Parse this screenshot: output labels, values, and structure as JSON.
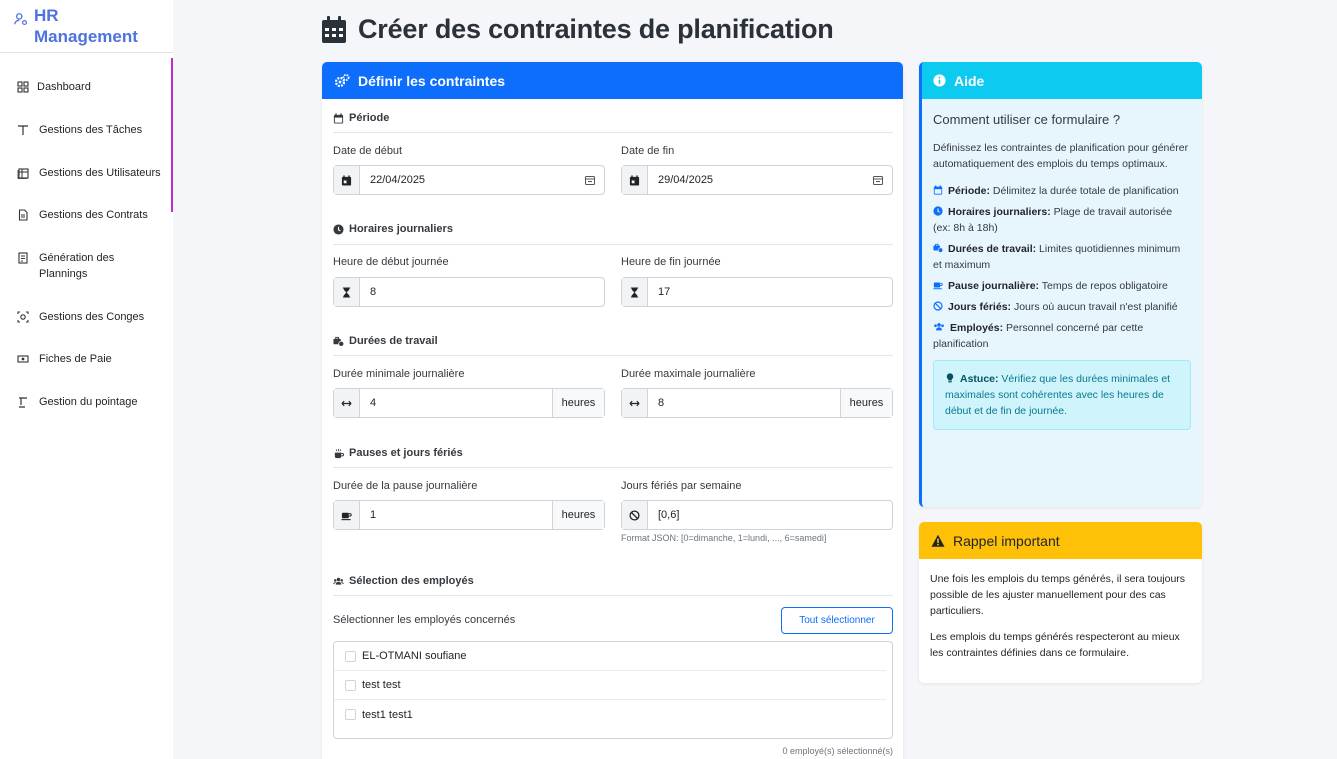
{
  "brand": {
    "line1": "HR",
    "line2": "Management"
  },
  "sidebar": {
    "items": [
      {
        "label": "Dashboard",
        "icon": "dashboard-icon"
      },
      {
        "label": "Gestions des Tâches",
        "icon": "tasks-icon"
      },
      {
        "label": "Gestions des Utilisateurs",
        "icon": "users-table-icon"
      },
      {
        "label": "Gestions des Contrats",
        "icon": "document-icon"
      },
      {
        "label": "Génération des Plannings",
        "icon": "planning-icon"
      },
      {
        "label": "Gestions des Conges",
        "icon": "leave-icon"
      },
      {
        "label": "Fiches de Paie",
        "icon": "payslip-icon"
      },
      {
        "label": "Gestion du pointage",
        "icon": "clock-in-icon"
      }
    ]
  },
  "page": {
    "title": "Créer des contraintes de planification"
  },
  "form": {
    "header": "Définir les contraintes",
    "period": {
      "title": "Période",
      "start_label": "Date de début",
      "start_value": "22/04/2025",
      "end_label": "Date de fin",
      "end_value": "29/04/2025"
    },
    "hours": {
      "title": "Horaires journaliers",
      "start_label": "Heure de début journée",
      "start_value": "8",
      "end_label": "Heure de fin journée",
      "end_value": "17"
    },
    "durations": {
      "title": "Durées de travail",
      "min_label": "Durée minimale journalière",
      "min_value": "4",
      "max_label": "Durée maximale journalière",
      "max_value": "8",
      "unit": "heures"
    },
    "breaks": {
      "title": "Pauses et jours fériés",
      "pause_label": "Durée de la pause journalière",
      "pause_value": "1",
      "unit": "heures",
      "holidays_label": "Jours fériés par semaine",
      "holidays_value": "[0,6]",
      "holidays_hint": "Format JSON: [0=dimanche, 1=lundi, ..., 6=samedi]"
    },
    "employees": {
      "title": "Sélection des employés",
      "select_label": "Sélectionner les employés concernés",
      "select_all": "Tout sélectionner",
      "list": [
        "EL-OTMANI soufiane",
        "test test",
        "test1 test1"
      ],
      "count_text": "0 employé(s) sélectionné(s)"
    }
  },
  "help": {
    "header": "Aide",
    "question": "Comment utiliser ce formulaire ?",
    "intro": "Définissez les contraintes de planification pour générer automatiquement des emplois du temps optimaux.",
    "items": [
      {
        "term": "Période:",
        "text": " Délimitez la durée totale de planification"
      },
      {
        "term": "Horaires journaliers:",
        "text": " Plage de travail autorisée (ex: 8h à 18h)"
      },
      {
        "term": "Durées de travail:",
        "text": " Limites quotidiennes minimum et maximum"
      },
      {
        "term": "Pause journalière:",
        "text": " Temps de repos obligatoire"
      },
      {
        "term": "Jours fériés:",
        "text": " Jours où aucun travail n'est planifié"
      },
      {
        "term": "Employés:",
        "text": " Personnel concerné par cette planification"
      }
    ],
    "tip_term": "Astuce:",
    "tip_text": " Vérifiez que les durées minimales et maximales sont cohérentes avec les heures de début et de fin de journée."
  },
  "warning": {
    "header": "Rappel important",
    "p1": "Une fois les emplois du temps générés, il sera toujours possible de les ajuster manuellement pour des cas particuliers.",
    "p2": "Les emplois du temps générés respecteront au mieux les contraintes définies dans ce formulaire."
  },
  "colors": {
    "primary": "#0d6efd",
    "info": "#0dcaf0",
    "warning": "#ffc107",
    "brand": "#4e73df",
    "nav_accent": "#c02bcf"
  }
}
